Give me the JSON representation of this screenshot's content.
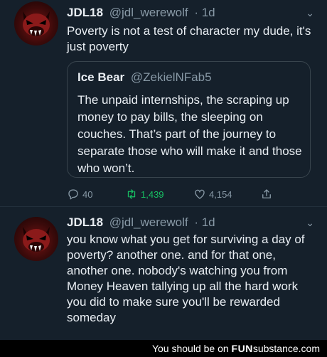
{
  "tweets": [
    {
      "name": "JDL18",
      "handle": "@jdl_werewolf",
      "time": "· 1d",
      "text": "Poverty is not a test of character my dude, it's just poverty",
      "quote": {
        "name": "Ice Bear",
        "handle": "@ZekielNFab5",
        "text": "The unpaid internships, the scraping up money to pay bills, the sleeping on couches. That’s part of the journey to separate those who will make it and those who won’t."
      },
      "actions": {
        "replies": "40",
        "retweets": "1,439",
        "likes": "4,154"
      },
      "icons": [
        "chevron-down-icon",
        "reply-icon",
        "retweet-icon",
        "like-icon",
        "share-icon"
      ]
    },
    {
      "name": "JDL18",
      "handle": "@jdl_werewolf",
      "time": "· 1d",
      "text": "you know what you get for surviving a day of poverty? another one. and for that one, another one. nobody's watching you from Money Heaven tallying up all the hard work you did to make sure you'll be rewarded someday"
    }
  ],
  "footer": {
    "prefix": "You should be on",
    "brand_fun": "FUN",
    "brand_rest": "substance",
    "brand_tld": ".com"
  },
  "colors": {
    "background": "#15202b",
    "text": "#e8edf2",
    "muted": "#8899a6",
    "retweet": "#17bf63",
    "border": "#38444d"
  }
}
